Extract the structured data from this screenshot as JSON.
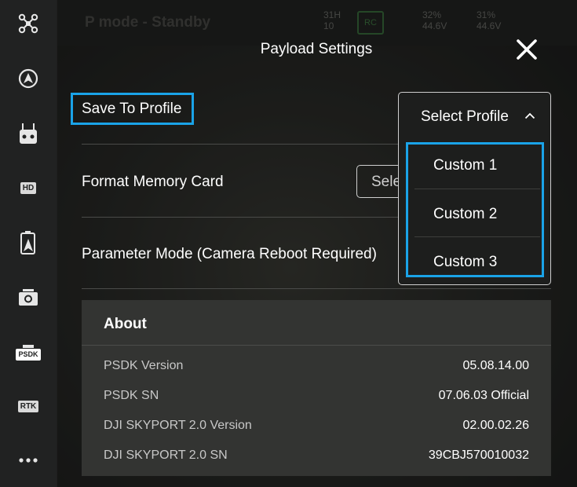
{
  "background": {
    "flight_mode": "P mode - Standby",
    "rc_badge": "RC",
    "battery_left": [
      "32%",
      "44.6V"
    ],
    "battery_right": [
      "31%",
      "44.6V"
    ],
    "gps_count": "10",
    "signal_label": "31H"
  },
  "sidebar": {
    "items": [
      {
        "icon": "drone-icon"
      },
      {
        "icon": "flight-control-icon"
      },
      {
        "icon": "remote-controller-icon"
      },
      {
        "icon": "hd-transmission-icon",
        "label": "HD"
      },
      {
        "icon": "battery-icon"
      },
      {
        "icon": "gimbal-camera-icon"
      },
      {
        "icon": "psdk-icon",
        "label": "PSDK"
      },
      {
        "icon": "rtk-icon",
        "label": "RTK"
      },
      {
        "icon": "more-icon"
      }
    ]
  },
  "modal": {
    "title": "Payload Settings",
    "save_to_profile_label": "Save To Profile",
    "format_memory_label": "Format Memory Card",
    "format_select_value": "Select Start to Format",
    "parameter_mode_label": "Parameter Mode (Camera Reboot Required)",
    "profile_dropdown": {
      "header": "Select Profile",
      "options": [
        "Custom 1",
        "Custom 2",
        "Custom 3"
      ]
    },
    "about": {
      "title": "About",
      "rows": [
        {
          "key": "PSDK Version",
          "value": "05.08.14.00"
        },
        {
          "key": "PSDK SN",
          "value": "07.06.03 Official"
        },
        {
          "key": "DJI SKYPORT 2.0 Version",
          "value": "02.00.02.26"
        },
        {
          "key": "DJI SKYPORT 2.0 SN",
          "value": "39CBJ570010032"
        }
      ]
    }
  },
  "colors": {
    "highlight": "#1aa3e8",
    "panel": "#333432",
    "sidebar": "#212222"
  }
}
